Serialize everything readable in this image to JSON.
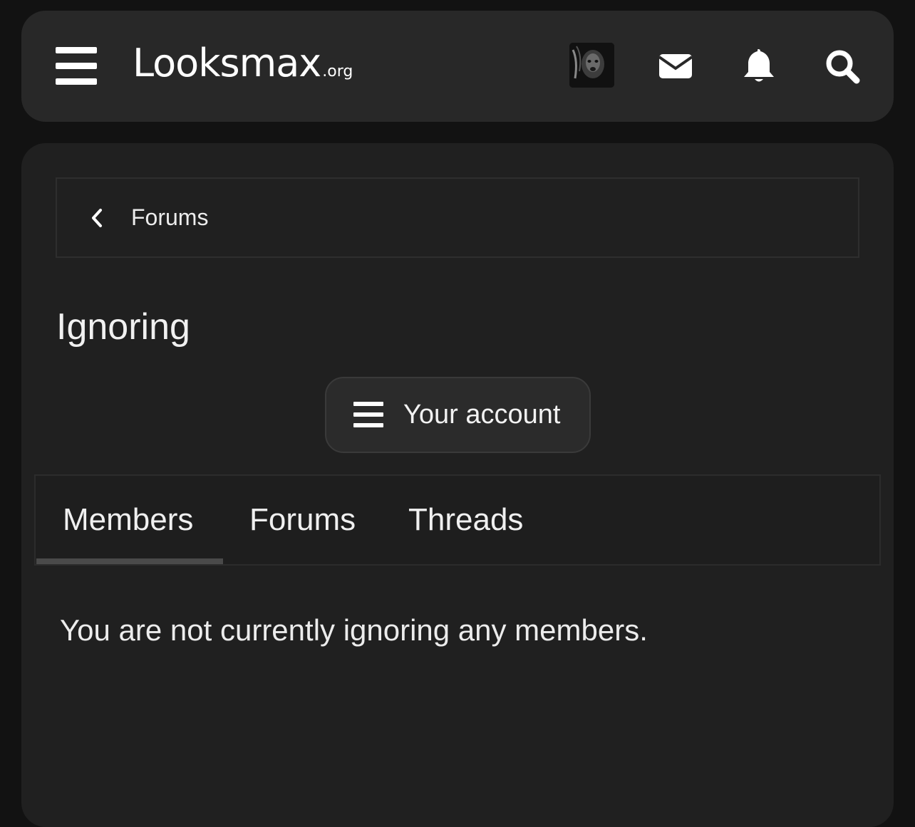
{
  "header": {
    "logo_main": "Looksmax",
    "logo_tld": ".org",
    "icons": [
      "hamburger-menu-icon",
      "avatar",
      "envelope-icon",
      "bell-icon",
      "search-icon"
    ]
  },
  "breadcrumb": {
    "label": "Forums"
  },
  "page": {
    "title": "Ignoring",
    "account_button_label": "Your account"
  },
  "tabs": [
    {
      "label": "Members",
      "active": true
    },
    {
      "label": "Forums",
      "active": false
    },
    {
      "label": "Threads",
      "active": false
    }
  ],
  "main": {
    "empty_message": "You are not currently ignoring any members."
  },
  "colors": {
    "background": "#121212",
    "surface": "#202020",
    "header": "#282828",
    "text": "#ececec"
  }
}
